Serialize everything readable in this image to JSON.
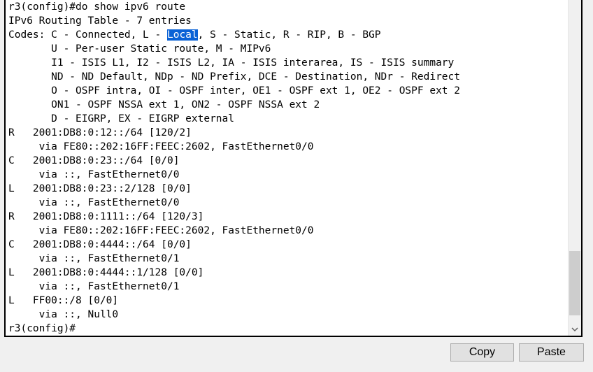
{
  "terminal": {
    "lines": [
      {
        "text": "r3(config)#do show ipv6 route"
      },
      {
        "text": "IPv6 Routing Table - 7 entries"
      },
      {
        "pre": "Codes: C - Connected, L - ",
        "hl": "Local",
        "post": ", S - Static, R - RIP, B - BGP"
      },
      {
        "text": "       U - Per-user Static route, M - MIPv6"
      },
      {
        "text": "       I1 - ISIS L1, I2 - ISIS L2, IA - ISIS interarea, IS - ISIS summary"
      },
      {
        "text": "       ND - ND Default, NDp - ND Prefix, DCE - Destination, NDr - Redirect"
      },
      {
        "text": "       O - OSPF intra, OI - OSPF inter, OE1 - OSPF ext 1, OE2 - OSPF ext 2"
      },
      {
        "text": "       ON1 - OSPF NSSA ext 1, ON2 - OSPF NSSA ext 2"
      },
      {
        "text": "       D - EIGRP, EX - EIGRP external"
      },
      {
        "text": "R   2001:DB8:0:12::/64 [120/2]"
      },
      {
        "text": "     via FE80::202:16FF:FEEC:2602, FastEthernet0/0"
      },
      {
        "text": "C   2001:DB8:0:23::/64 [0/0]"
      },
      {
        "text": "     via ::, FastEthernet0/0"
      },
      {
        "text": "L   2001:DB8:0:23::2/128 [0/0]"
      },
      {
        "text": "     via ::, FastEthernet0/0"
      },
      {
        "text": "R   2001:DB8:0:1111::/64 [120/3]"
      },
      {
        "text": "     via FE80::202:16FF:FEEC:2602, FastEthernet0/0"
      },
      {
        "text": "C   2001:DB8:0:4444::/64 [0/0]"
      },
      {
        "text": "     via ::, FastEthernet0/1"
      },
      {
        "text": "L   2001:DB8:0:4444::1/128 [0/0]"
      },
      {
        "text": "     via ::, FastEthernet0/1"
      },
      {
        "text": "L   FF00::/8 [0/0]"
      },
      {
        "text": "     via ::, Null0"
      },
      {
        "text": "r3(config)#"
      }
    ],
    "highlight_color": "#0a62d6"
  },
  "scrollbar": {
    "position": 0.97,
    "down_icon": "chevron-down-icon"
  },
  "buttons": {
    "copy_label": "Copy",
    "paste_label": "Paste"
  }
}
